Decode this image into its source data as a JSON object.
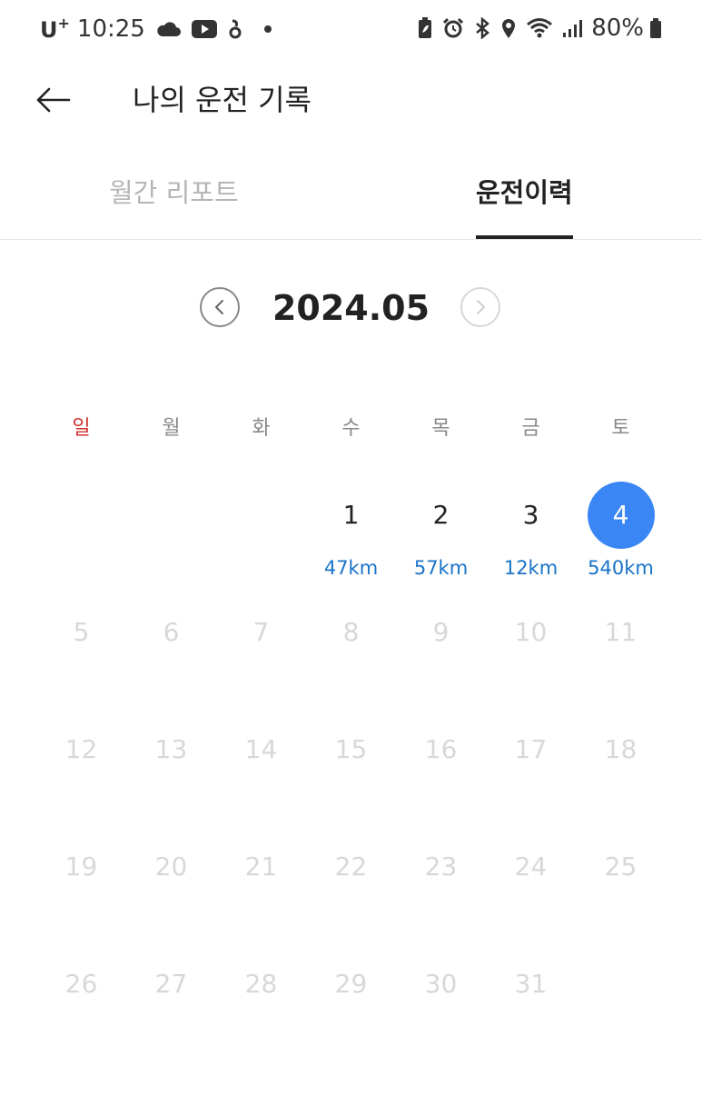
{
  "status_bar": {
    "carrier": "U",
    "carrier_sup": "+",
    "time": "10:25",
    "battery_pct": "80%",
    "icons_left": [
      "cloud-icon",
      "youtube-icon",
      "hook-icon",
      "dot-icon"
    ],
    "icons_right": [
      "battery-saver-icon",
      "alarm-icon",
      "bluetooth-icon",
      "location-icon",
      "wifi-icon",
      "signal-icon",
      "battery-icon"
    ]
  },
  "app_bar": {
    "title": "나의 운전 기록"
  },
  "tabs": {
    "monthly": "월간 리포트",
    "history": "운전이력",
    "active": "history"
  },
  "month_selector": {
    "label": "2024.05"
  },
  "weekdays": [
    "일",
    "월",
    "화",
    "수",
    "목",
    "금",
    "토"
  ],
  "calendar": {
    "selected_day": "4",
    "week1": [
      {
        "day": "",
        "km": ""
      },
      {
        "day": "",
        "km": ""
      },
      {
        "day": "",
        "km": ""
      },
      {
        "day": "1",
        "km": "47km"
      },
      {
        "day": "2",
        "km": "57km"
      },
      {
        "day": "3",
        "km": "12km"
      },
      {
        "day": "4",
        "km": "540km"
      }
    ],
    "week2": [
      "5",
      "6",
      "7",
      "8",
      "9",
      "10",
      "11"
    ],
    "week3": [
      "12",
      "13",
      "14",
      "15",
      "16",
      "17",
      "18"
    ],
    "week4": [
      "19",
      "20",
      "21",
      "22",
      "23",
      "24",
      "25"
    ],
    "week5": [
      "26",
      "27",
      "28",
      "29",
      "30",
      "31",
      ""
    ]
  },
  "colors": {
    "accent": "#3a86f5",
    "km_text": "#1a73c8",
    "sunday": "#d32f2f",
    "disabled": "#d8d8d8"
  }
}
